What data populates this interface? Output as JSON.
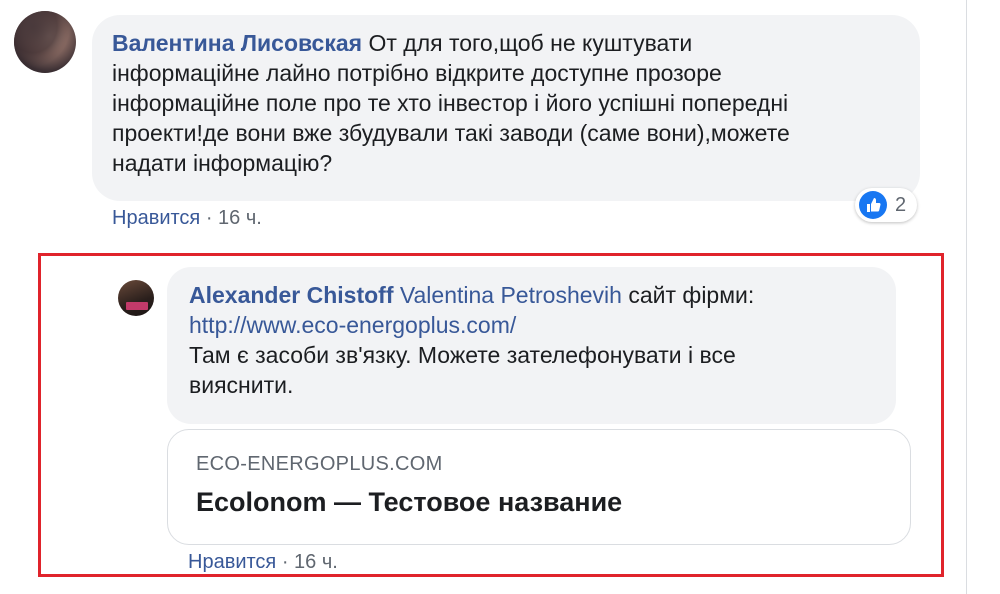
{
  "main_comment": {
    "author": "Валентина Лисовская",
    "text_lines": [
      " От для того,щоб не куштувати",
      "інформаційне лайно потрібно відкрите доступне прозоре",
      "інформаційне поле про те хто інвестор і його успішні попередні",
      "проекти!де вони вже збудували такі заводи (саме вони),можете",
      "надати інформацію?"
    ],
    "like_label": "Нравится",
    "separator": " · ",
    "time": "16 ч.",
    "reaction_count": "2",
    "reaction_icon": "thumbs-up-icon",
    "reaction_color": "#1877f2"
  },
  "reply": {
    "author": "Alexander Chistoff",
    "mention": "Valentina Petroshevih",
    "text_after_mention": " сайт фірми:",
    "link": "http://www.eco-energoplus.com/",
    "text_lines": [
      "Там є засоби зв'язку. Можете зателефонувати і все",
      "вияснити."
    ],
    "like_label": "Нравится",
    "separator": " · ",
    "time": "16 ч."
  },
  "link_preview": {
    "domain": "ECO-ENERGOPLUS.COM",
    "title": "Ecolonom — Тестовое название"
  },
  "colors": {
    "name_link": "#385898",
    "bubble_bg": "#f2f3f5",
    "highlight_border": "#e0232b",
    "muted_text": "#606770"
  }
}
